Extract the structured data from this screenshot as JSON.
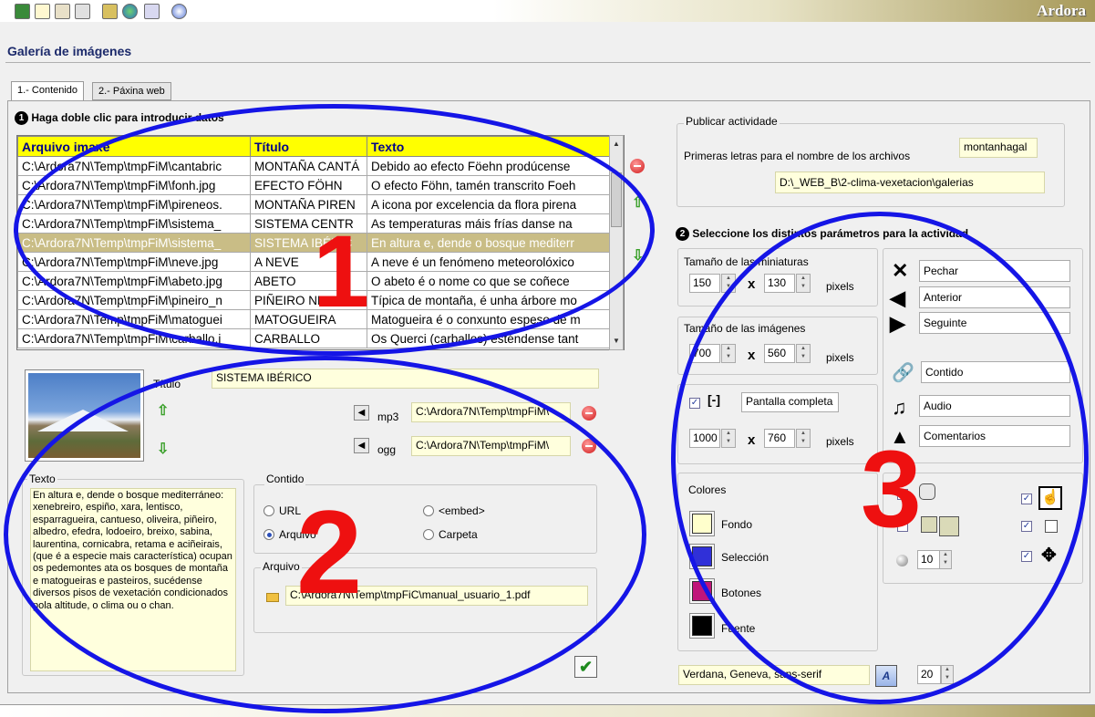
{
  "app": {
    "brand": "Ardora",
    "title": "Galería de imágenes"
  },
  "tabs": [
    {
      "label": "1.- Contenido",
      "active": true
    },
    {
      "label": "2.- Páxina web",
      "active": false
    }
  ],
  "data_section": {
    "number": "1",
    "heading": "Haga doble clic para introducir datos"
  },
  "grid": {
    "columns": [
      "Arquivo imaxe",
      "Título",
      "Texto"
    ],
    "rows": [
      [
        "C:\\Ardora7N\\Temp\\tmpFiM\\cantabric",
        "MONTAÑA CANTÁ",
        "Debido ao efecto Föehn prodúcense"
      ],
      [
        "C:\\Ardora7N\\Temp\\tmpFiM\\fonh.jpg",
        "EFECTO FÖHN",
        "O efecto Föhn, tamén transcrito Foeh"
      ],
      [
        "C:\\Ardora7N\\Temp\\tmpFiM\\pireneos.",
        "MONTAÑA PIREN",
        "A icona por excelencia da flora pirena"
      ],
      [
        "C:\\Ardora7N\\Temp\\tmpFiM\\sistema_",
        "SISTEMA CENTR",
        "As temperaturas máis frías danse na"
      ],
      [
        "C:\\Ardora7N\\Temp\\tmpFiM\\sistema_",
        "SISTEMA IBÉRIC",
        "En altura e, dende o bosque mediterr"
      ],
      [
        "C:\\Ardora7N\\Temp\\tmpFiM\\neve.jpg",
        "A NEVE",
        "A neve é un fenómeno meteorolóxico"
      ],
      [
        "C:\\Ardora7N\\Temp\\tmpFiM\\abeto.jpg",
        "ABETO",
        "O abeto é o nome co que se coñece"
      ],
      [
        "C:\\Ardora7N\\Temp\\tmpFiM\\pineiro_n",
        "PIÑEIRO NEGRO",
        "Típica de montaña, é unha árbore mo"
      ],
      [
        "C:\\Ardora7N\\Temp\\tmpFiM\\matoguei",
        "MATOGUEIRA",
        "Matogueira é o conxunto espeso de m"
      ],
      [
        "C:\\Ardora7N\\Temp\\tmpFiM\\carballo.j",
        "CARBALLO",
        "Os Querci (carballos) esténdense tant"
      ]
    ],
    "selected_row": 4
  },
  "detail": {
    "title_label": "Título",
    "title_value": "SISTEMA IBÉRICO",
    "mp3_label": "mp3",
    "mp3_value": "C:\\Ardora7N\\Temp\\tmpFiM\\",
    "ogg_label": "ogg",
    "ogg_value": "C:\\Ardora7N\\Temp\\tmpFiM\\",
    "texto_label": "Texto",
    "texto_value": "En altura e, dende o bosque mediterráneo: xenebreiro, espiño, xara, lentisco, esparragueira, cantueso, oliveira, piñeiro, albedro, efedra, lodoeiro, breixo, sabina, laurentina, cornicabra, retama e aciñeirais, (que é a especie mais característica) ocupan os pedemontes ata os bosques de montaña e matogueiras e pasteiros, sucédense diversos pisos de vexetación condicionados pola altitude, o clima ou o chan.",
    "contido_label": "Contido",
    "radio_url": "URL",
    "radio_embed": "<embed>",
    "radio_arquivo": "Arquivo",
    "radio_carpeta": "Carpeta",
    "arquivo_label": "Arquivo",
    "arquivo_value": "C:\\Ardora7N\\Temp\\tmpFiC\\manual_usuario_1.pdf"
  },
  "publish": {
    "group_label": "Publicar actividade",
    "prefix_label": "Primeras letras para el nombre de los archivos",
    "prefix_value": "montanhagal",
    "path_value": "D:\\_WEB_B\\2-clima-vexetacion\\galerias"
  },
  "params_section": {
    "number": "2",
    "heading": "Seleccione los distintos parámetros para la actividad"
  },
  "params": {
    "thumb_label": "Tamaño de las miniaturas",
    "thumb_w": "150",
    "thumb_h": "130",
    "img_label": "Tamaño de las imágenes",
    "img_w": "700",
    "img_h": "560",
    "full_label": "Pantalla completa",
    "full_w": "1000",
    "full_h": "760",
    "x_sep": "x",
    "pixels": "pixels",
    "colors_label": "Colores",
    "color_fondo": "Fondo",
    "color_seleccion": "Selección",
    "color_botones": "Botones",
    "color_fuente": "Fuente",
    "nav_pechar": "Pechar",
    "nav_anterior": "Anterior",
    "nav_seguinte": "Seguinte",
    "nav_contido": "Contido",
    "nav_audio": "Audio",
    "nav_comentarios": "Comentarios",
    "opacity_value": "10",
    "font_value": "Verdana, Geneva, sans-serif",
    "font_size": "20"
  },
  "annotations": {
    "n1": "1",
    "n2": "2",
    "n3": "3"
  },
  "colors": {
    "fondo": "#ffffcc",
    "seleccion": "#3030d8",
    "botones": "#c0157a",
    "fuente": "#000000",
    "header_yellow": "#ffff00",
    "selected_row": "#c9bd86",
    "annotation_blue": "#1515e6",
    "annotation_red": "#ee1010"
  }
}
